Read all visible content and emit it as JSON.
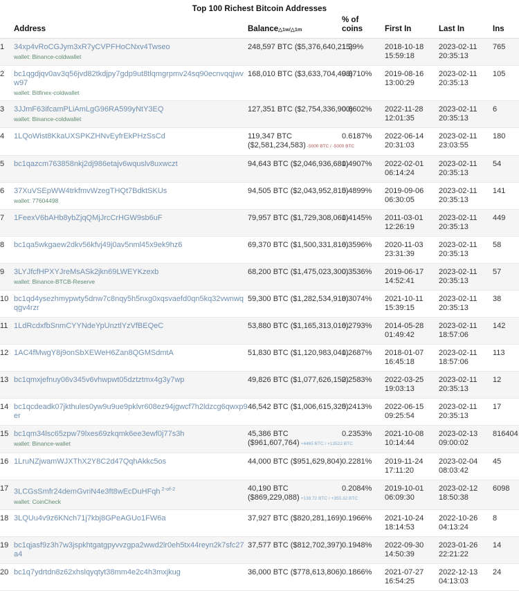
{
  "page": {
    "title": "Top 100 Richest Bitcoin Addresses"
  },
  "table": {
    "columns": {
      "rank": "",
      "address": "Address",
      "balance": "Balance",
      "balance_delta_note": "△1w/△1m",
      "percent_of_coins_line1": "% of",
      "percent_of_coins_line2": "coins",
      "first_in": "First In",
      "last_in": "Last In",
      "ins": "Ins"
    },
    "rows": [
      {
        "rank": "1",
        "address": "34xp4vRoCGJym3xR7yCVPFHoCNxv4Twseo",
        "wallet": "wallet: Binance-coldwallet",
        "sup": "",
        "btc": "248,597 BTC",
        "usd": "($5,376,640,215)",
        "delta": "",
        "delta_sign": "",
        "two_line_balance": false,
        "percent": "1.29%",
        "first_in_date": "2018-10-18",
        "first_in_time": "15:59:18",
        "last_in_date": "2023-02-11",
        "last_in_time": "20:35:13",
        "ins": "765"
      },
      {
        "rank": "2",
        "address": "bc1qgdjqv0av3q56jvd82tkdjpy7gdp9ut8tlqmgrpmv24sq90ecnvqqjwvw97",
        "wallet": "wallet: Bitfinex-coldwallet",
        "sup": "",
        "btc": "168,010 BTC",
        "usd": "($3,633,704,498)",
        "delta": "",
        "delta_sign": "",
        "two_line_balance": false,
        "percent": "0.8710%",
        "first_in_date": "2019-08-16",
        "first_in_time": "13:00:29",
        "last_in_date": "2023-02-11",
        "last_in_time": "20:35:13",
        "ins": "105"
      },
      {
        "rank": "3",
        "address": "3JJmF63ifcamPLiAmLgG96RA599yNtY3EQ",
        "wallet": "wallet: Binance-coldwallet",
        "sup": "",
        "btc": "127,351 BTC",
        "usd": "($2,754,336,900)",
        "delta": "",
        "delta_sign": "",
        "two_line_balance": false,
        "percent": "0.6602%",
        "first_in_date": "2022-11-28",
        "first_in_time": "12:01:35",
        "last_in_date": "2023-02-11",
        "last_in_time": "20:35:13",
        "ins": "6"
      },
      {
        "rank": "4",
        "address": "1LQoWist8KkaUXSPKZHNvEyfrEkPHzSsCd",
        "wallet": "",
        "sup": "",
        "btc": "119,347 BTC",
        "usd": "($2,581,234,583)",
        "delta": "-5000 BTC / -5000 BTC",
        "delta_sign": "neg",
        "two_line_balance": true,
        "percent": "0.6187%",
        "first_in_date": "2022-06-14",
        "first_in_time": "20:31:03",
        "last_in_date": "2023-02-11",
        "last_in_time": "23:03:55",
        "ins": "180"
      },
      {
        "rank": "5",
        "address": "bc1qazcm763858nkj2dj986etajv6wquslv8uxwczt",
        "wallet": "",
        "sup": "",
        "btc": "94,643 BTC",
        "usd": "($2,046,936,681)",
        "delta": "",
        "delta_sign": "",
        "two_line_balance": false,
        "percent": "0.4907%",
        "first_in_date": "2022-02-01",
        "first_in_time": "06:14:24",
        "last_in_date": "2023-02-11",
        "last_in_time": "20:35:13",
        "ins": "54"
      },
      {
        "rank": "6",
        "address": "37XuVSEpWW4trkfmvWzegTHQt7BdktSKUs",
        "wallet": "wallet: 77604498",
        "sup": "",
        "btc": "94,505 BTC",
        "usd": "($2,043,952,815)",
        "delta": "",
        "delta_sign": "",
        "two_line_balance": false,
        "percent": "0.4899%",
        "first_in_date": "2019-09-06",
        "first_in_time": "06:30:05",
        "last_in_date": "2023-02-11",
        "last_in_time": "20:35:13",
        "ins": "141"
      },
      {
        "rank": "7",
        "address": "1FeexV6bAHb8ybZjqQMjJrcCrHGW9sb6uF",
        "wallet": "",
        "sup": "",
        "btc": "79,957 BTC",
        "usd": "($1,729,308,061)",
        "delta": "",
        "delta_sign": "",
        "two_line_balance": false,
        "percent": "0.4145%",
        "first_in_date": "2011-03-01",
        "first_in_time": "12:26:19",
        "last_in_date": "2023-02-11",
        "last_in_time": "20:35:13",
        "ins": "449"
      },
      {
        "rank": "8",
        "address": "bc1qa5wkgaew2dkv56kfvj49j0av5nml45x9ek9hz6",
        "wallet": "",
        "sup": "",
        "btc": "69,370 BTC",
        "usd": "($1,500,331,816)",
        "delta": "",
        "delta_sign": "",
        "two_line_balance": false,
        "percent": "0.3596%",
        "first_in_date": "2020-11-03",
        "first_in_time": "23:31:39",
        "last_in_date": "2023-02-11",
        "last_in_time": "20:35:13",
        "ins": "58"
      },
      {
        "rank": "9",
        "address": "3LYJfcfHPXYJreMsASk2jkn69LWEYKzexb",
        "wallet": "wallet: Binance-BTCB-Reserve",
        "sup": "",
        "btc": "68,200 BTC",
        "usd": "($1,475,023,300)",
        "delta": "",
        "delta_sign": "",
        "two_line_balance": false,
        "percent": "0.3536%",
        "first_in_date": "2019-06-17",
        "first_in_time": "14:52:41",
        "last_in_date": "2023-02-11",
        "last_in_time": "20:35:13",
        "ins": "57"
      },
      {
        "rank": "10",
        "address": "bc1qd4ysezhmypwty5dnw7c8nqy5h5nxg0xqsvaefd0qn5kq32vwnwqqgv4rzr",
        "wallet": "",
        "sup": "",
        "btc": "59,300 BTC",
        "usd": "($1,282,534,918)",
        "delta": "",
        "delta_sign": "",
        "two_line_balance": false,
        "percent": "0.3074%",
        "first_in_date": "2021-10-11",
        "first_in_time": "15:39:15",
        "last_in_date": "2023-02-11",
        "last_in_time": "20:35:13",
        "ins": "38"
      },
      {
        "rank": "11",
        "address": "1LdRcdxfbSnmCYYNdeYpUnztlYzVfBEQeC",
        "wallet": "",
        "sup": "",
        "btc": "53,880 BTC",
        "usd": "($1,165,313,016)",
        "delta": "",
        "delta_sign": "",
        "two_line_balance": false,
        "percent": "0.2793%",
        "first_in_date": "2014-05-28",
        "first_in_time": "01:49:42",
        "last_in_date": "2023-02-11",
        "last_in_time": "18:57:06",
        "ins": "142"
      },
      {
        "rank": "12",
        "address": "1AC4fMwgY8j9onSbXEWeH6Zan8QGMSdmtA",
        "wallet": "",
        "sup": "",
        "btc": "51,830 BTC",
        "usd": "($1,120,983,041)",
        "delta": "",
        "delta_sign": "",
        "two_line_balance": false,
        "percent": "0.2687%",
        "first_in_date": "2018-01-07",
        "first_in_time": "16:45:18",
        "last_in_date": "2023-02-11",
        "last_in_time": "18:57:06",
        "ins": "113"
      },
      {
        "rank": "13",
        "address": "bc1qmxjefnuy06v345v6vhwpwt05dztztmx4g3y7wp",
        "wallet": "",
        "sup": "",
        "btc": "49,826 BTC",
        "usd": "($1,077,626,152)",
        "delta": "",
        "delta_sign": "",
        "two_line_balance": false,
        "percent": "0.2583%",
        "first_in_date": "2022-03-25",
        "first_in_time": "19:03:13",
        "last_in_date": "2023-02-11",
        "last_in_time": "20:35:13",
        "ins": "12"
      },
      {
        "rank": "14",
        "address": "bc1qcdeadk07jkthules0yw9u9ue9pklvr608ez94jgwcf7h2ldzcg6qwxp9er",
        "wallet": "",
        "sup": "",
        "btc": "46,542 BTC",
        "usd": "($1,006,615,325)",
        "delta": "",
        "delta_sign": "",
        "two_line_balance": false,
        "percent": "0.2413%",
        "first_in_date": "2022-06-15",
        "first_in_time": "09:25:54",
        "last_in_date": "2023-02-11",
        "last_in_time": "20:35:13",
        "ins": "17"
      },
      {
        "rank": "15",
        "address": "bc1qm34lsc65zpw79lxes69zkqmk6ee3ewf0j77s3h",
        "wallet": "wallet: Binance-wallet",
        "sup": "",
        "btc": "45,386 BTC",
        "usd": "($961,607,764)",
        "delta": "+4465 BTC / +13522 BTC",
        "delta_sign": "pos",
        "two_line_balance": true,
        "percent": "0.2353%",
        "first_in_date": "2021-10-08",
        "first_in_time": "10:14:44",
        "last_in_date": "2023-02-13",
        "last_in_time": "09:00:02",
        "ins": "816404"
      },
      {
        "rank": "16",
        "address": "1LruNZjwamWJXThX2Y8C2d47QqhAkkc5os",
        "wallet": "",
        "sup": "",
        "btc": "44,000 BTC",
        "usd": "($951,629,804)",
        "delta": "",
        "delta_sign": "",
        "two_line_balance": false,
        "percent": "0.2281%",
        "first_in_date": "2019-11-24",
        "first_in_time": "17:11:20",
        "last_in_date": "2023-02-04",
        "last_in_time": "08:03:42",
        "ins": "45"
      },
      {
        "rank": "17",
        "address": "3LCGsSmfr24demGvriN4e3ft8wEcDuHFqh",
        "wallet": "wallet: CoinCheck",
        "sup": "2-of-2",
        "btc": "40,190 BTC",
        "usd": "($869,229,088)",
        "delta": "+138.72 BTC / +355.32 BTC",
        "delta_sign": "pos",
        "two_line_balance": true,
        "percent": "0.2084%",
        "first_in_date": "2019-10-01",
        "first_in_time": "06:09:30",
        "last_in_date": "2023-02-12",
        "last_in_time": "18:50:38",
        "ins": "6098"
      },
      {
        "rank": "18",
        "address": "3LQUu4v9z6KNch71j7kbj8GPeAGUo1FW6a",
        "wallet": "",
        "sup": "",
        "btc": "37,927 BTC",
        "usd": "($820,281,169)",
        "delta": "",
        "delta_sign": "",
        "two_line_balance": false,
        "percent": "0.1966%",
        "first_in_date": "2021-10-24",
        "first_in_time": "18:14:53",
        "last_in_date": "2022-10-26",
        "last_in_time": "04:13:24",
        "ins": "8"
      },
      {
        "rank": "19",
        "address": "bc1qjasf9z3h7w3jspkhtgatgpyvvzgpa2wwd2lr0eh5tx44reyn2k7sfc27a4",
        "wallet": "",
        "sup": "",
        "btc": "37,577 BTC",
        "usd": "($812,702,397)",
        "delta": "",
        "delta_sign": "",
        "two_line_balance": false,
        "percent": "0.1948%",
        "first_in_date": "2022-09-30",
        "first_in_time": "14:50:39",
        "last_in_date": "2023-01-26",
        "last_in_time": "22:21:22",
        "ins": "14"
      },
      {
        "rank": "20",
        "address": "bc1q7ydrtdn8z62xhslqyqtyt38mm4e2c4h3mxjkug",
        "wallet": "",
        "sup": "",
        "btc": "36,000 BTC",
        "usd": "($778,613,806)",
        "delta": "",
        "delta_sign": "",
        "two_line_balance": false,
        "percent": "0.1866%",
        "first_in_date": "2021-07-27",
        "first_in_time": "16:54:25",
        "last_in_date": "2022-12-13",
        "last_in_time": "04:13:03",
        "ins": "24"
      }
    ]
  }
}
